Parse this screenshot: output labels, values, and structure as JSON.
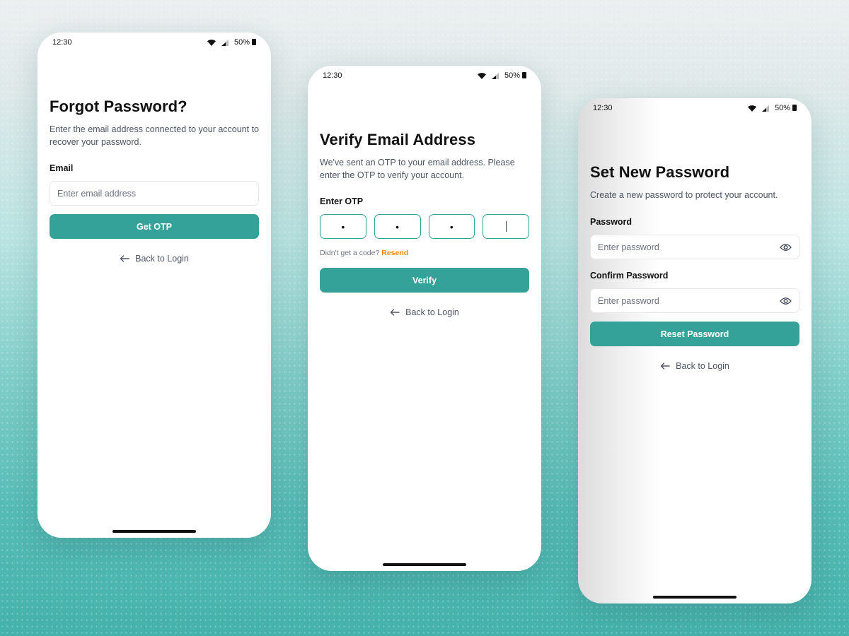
{
  "status": {
    "time": "12:30",
    "battery": "50%"
  },
  "screen1": {
    "title": "Forgot Password?",
    "subtitle": "Enter the email address connected to your account to recover your password.",
    "email_label": "Email",
    "email_placeholder": "Enter email address",
    "button": "Get OTP",
    "back": "Back to Login"
  },
  "screen2": {
    "title": "Verify Email Address",
    "subtitle": "We've sent an OTP to your email address. Please enter the OTP to verify your account.",
    "otp_label": "Enter OTP",
    "otp": [
      "•",
      "•",
      "•",
      ""
    ],
    "resend_prompt": "Didn't get a code?",
    "resend_link": "Resend",
    "button": "Verify",
    "back": "Back to Login"
  },
  "screen3": {
    "title": "Set New Password",
    "subtitle": "Create a new password to protect your account.",
    "password_label": "Password",
    "password_placeholder": "Enter password",
    "confirm_label": "Confirm Password",
    "confirm_placeholder": "Enter password",
    "button": "Reset Password",
    "back": "Back to Login"
  },
  "icons": {
    "back": "arrow-left-icon",
    "eye": "eye-icon",
    "wifi": "wifi-icon",
    "signal": "signal-icon",
    "battery": "battery-icon"
  },
  "colors": {
    "primary": "#35a299",
    "link": "#f08a0b",
    "text": "#111111",
    "muted": "#4b5563"
  }
}
